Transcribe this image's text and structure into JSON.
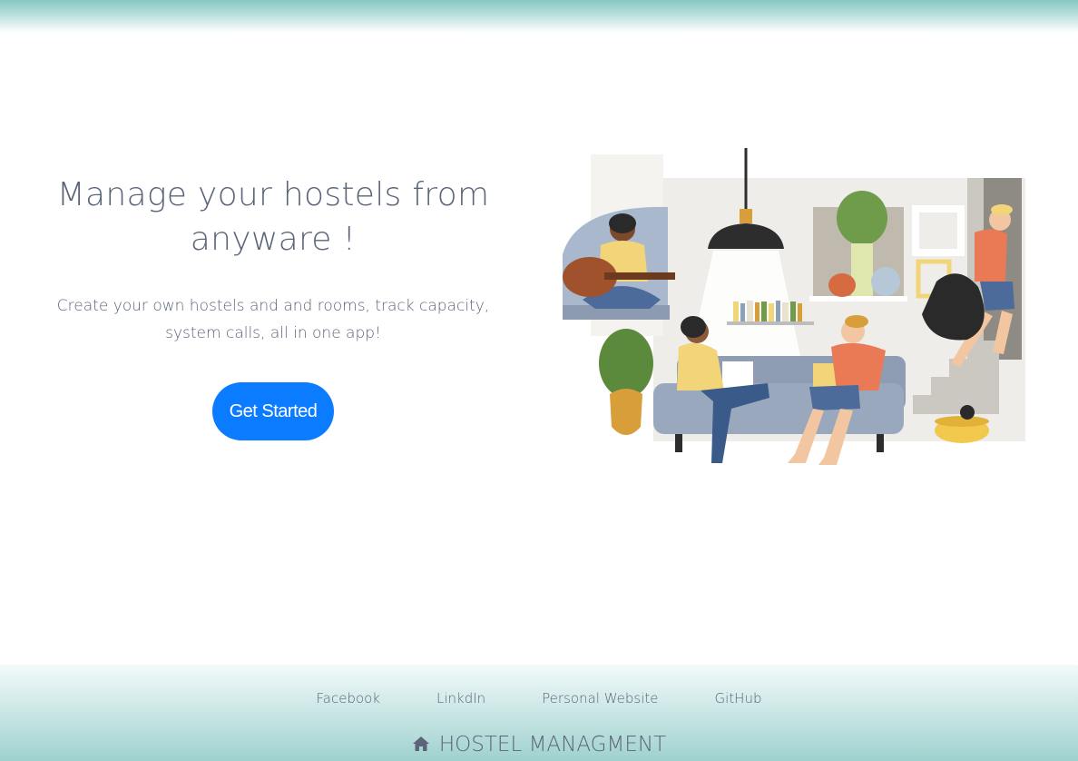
{
  "hero": {
    "title_line1": "Manage your hostels from",
    "title_line2": "anyware !",
    "subtitle_line1": "Create your own hostels and and rooms, track capacity,",
    "subtitle_line2": "system calls, all in one app!",
    "cta_label": "Get Started"
  },
  "footer": {
    "links": [
      {
        "label": "Facebook"
      },
      {
        "label": "LinkdIn"
      },
      {
        "label": "Personal Website"
      },
      {
        "label": "GitHub"
      }
    ],
    "brand_icon": "home-icon",
    "brand_label": "HOSTEL MANAGMENT"
  },
  "colors": {
    "accent": "#0b7bff",
    "text": "#5b6579",
    "teal": "#86c7c3"
  }
}
